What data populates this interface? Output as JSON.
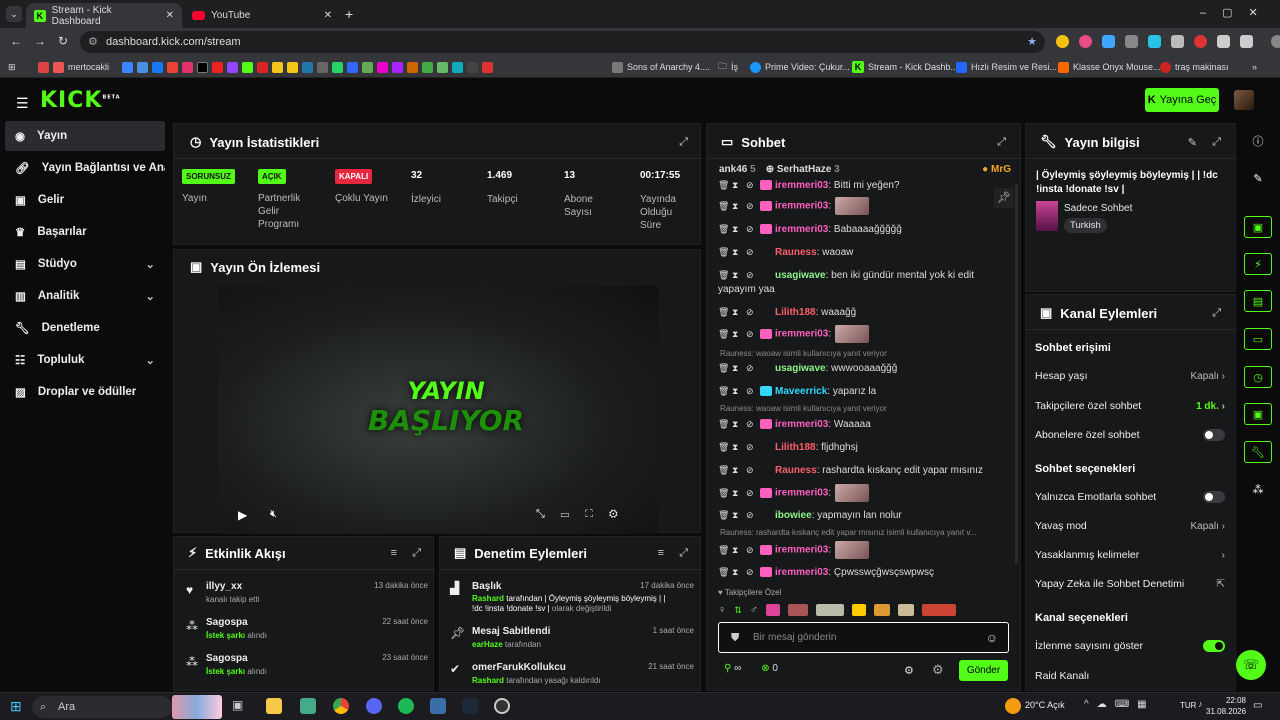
{
  "browser": {
    "tabs": [
      {
        "title": "Stream - Kick Dashboard",
        "active": true
      },
      {
        "title": "YouTube",
        "active": false
      }
    ],
    "url": "dashboard.kick.com/stream",
    "bookmarks": [
      "mertocakli",
      "Sons of Anarchy 4....",
      "İş",
      "Prime Video: Çukur...",
      "Stream - Kick Dashb...",
      "Hızlı Resim ve Resi...",
      "Klasse Onyx Mouse...",
      "traş makinası"
    ]
  },
  "app": {
    "logo": "KICK",
    "logo_sup": "BETA",
    "go_live": "Yayına Geç"
  },
  "sidebar": {
    "items": [
      {
        "label": "Yayın",
        "icon": "broadcast-icon",
        "active": true
      },
      {
        "label": "Yayın Bağlantısı ve Anahtarı",
        "icon": "link-icon"
      },
      {
        "label": "Gelir",
        "icon": "money-icon"
      },
      {
        "label": "Başarılar",
        "icon": "trophy-icon"
      },
      {
        "label": "Stüdyo",
        "icon": "studio-icon",
        "chevron": true
      },
      {
        "label": "Analitik",
        "icon": "chart-icon",
        "chevron": true
      },
      {
        "label": "Denetleme",
        "icon": "wrench-icon"
      },
      {
        "label": "Topluluk",
        "icon": "community-icon",
        "chevron": true
      },
      {
        "label": "Droplar ve ödüller",
        "icon": "gift-icon"
      }
    ]
  },
  "stats": {
    "title": "Yayın İstatistikleri",
    "items": [
      {
        "badge": "SORUNSUZ",
        "label": "Yayın"
      },
      {
        "badge": "AÇIK",
        "label": "Partnerlik Gelir Programı"
      },
      {
        "badge": "KAPALI",
        "label": "Çoklu Yayın"
      },
      {
        "value": "32",
        "label": "İzleyici"
      },
      {
        "value": "1.469",
        "label": "Takipçi"
      },
      {
        "value": "13",
        "label": "Abone Sayısı"
      },
      {
        "value": "00:17:55",
        "label": "Yayında Olduğu Süre"
      }
    ]
  },
  "preview": {
    "title": "Yayın Ön İzlemesi",
    "overlay_line1": "YAYIN",
    "overlay_line2": "BAŞLIYOR"
  },
  "activity": {
    "title": "Etkinlik Akışı",
    "items": [
      {
        "user": "illyy_xx",
        "text": "kanalı takip etti",
        "time": "13 dakika önce",
        "icon": "heart-icon"
      },
      {
        "user": "Sagospa",
        "hl": "İstek şarkı",
        "text": " alındı",
        "time": "22 saat önce",
        "icon": "puzzle-icon"
      },
      {
        "user": "Sagospa",
        "hl": "İstek şarkı",
        "text": " alındı",
        "time": "23 saat önce",
        "icon": "puzzle-icon"
      }
    ]
  },
  "mod_actions": {
    "title": "Denetim Eylemleri",
    "items": [
      {
        "title": "Başlık",
        "time": "17 dakika önce",
        "actor": "Rashard",
        "line1": " tarafından | Öyleymiş şöyleymiş böyleymiş | |",
        "line2": "!dc !insta !donate !sv |",
        "line2b": " olarak değiştirildi",
        "icon": "factory-icon"
      },
      {
        "title": "Mesaj Sabitlendi",
        "time": "1 saat önce",
        "actor": "earHaze",
        "line1": " tarafından",
        "icon": "pin-icon"
      },
      {
        "title": "omerFarukKollukcu",
        "time": "21 saat önce",
        "actor": "Rashard",
        "line1": " tarafından yasağı kaldırıldı",
        "icon": "check-circle-icon"
      }
    ]
  },
  "chat": {
    "title": "Sohbet",
    "top_users": [
      {
        "name": "ank46",
        "count": "5"
      },
      {
        "name": "SerhatHaze",
        "count": "3"
      },
      {
        "name": "MrG",
        "count": ""
      }
    ],
    "messages": [
      {
        "user": "iremmeri03",
        "cls": "u-pink",
        "text": ": Bitti mi yeğen?"
      },
      {
        "user": "iremmeri03",
        "cls": "u-pink",
        "text": ":",
        "img": true
      },
      {
        "user": "iremmeri03",
        "cls": "u-pink",
        "text": ": Babaaaağğğğğ"
      },
      {
        "user": "Rauness",
        "cls": "u-red",
        "text": ": waoaw"
      },
      {
        "user": "usagiwave",
        "cls": "u-lg",
        "text": ": ben iki gündür mental yok ki edit yapayım yaa"
      },
      {
        "user": "Lilith188",
        "cls": "u-red",
        "text": ": waaağğ"
      },
      {
        "user": "iremmeri03",
        "cls": "u-pink",
        "text": ":",
        "img": true
      },
      {
        "reply": "Rauness: waoaw isimli kullanıcıya yanıt veriyor"
      },
      {
        "user": "usagiwave",
        "cls": "u-lg",
        "text": ": wwwooaaağğğ"
      },
      {
        "user": "Maveerrick",
        "cls": "u-cyan",
        "text": ": yaparız la"
      },
      {
        "reply": "Rauness: waoaw isimli kullanıcıya yanıt veriyor"
      },
      {
        "user": "iremmeri03",
        "cls": "u-pink",
        "text": ": Waaaaa"
      },
      {
        "user": "Lilith188",
        "cls": "u-red",
        "text": ": fljdhghsj"
      },
      {
        "user": "Rauness",
        "cls": "u-red",
        "text": ": rashardta kıskanç edit yapar mısınız"
      },
      {
        "user": "iremmeri03",
        "cls": "u-pink",
        "text": ":",
        "img": true
      },
      {
        "user": "ibowiee",
        "cls": "u-lg",
        "text": ": yapmayın lan nolur"
      },
      {
        "reply": "Rauness: rashardta kıskanç edit yapar mısınız isimli kullanıcıya yanıt v..."
      },
      {
        "user": "iremmeri03",
        "cls": "u-pink",
        "text": ":",
        "img": true
      },
      {
        "user": "iremmeri03",
        "cls": "u-pink",
        "text": ": Çpwsswçğwsçswpwsç"
      }
    ],
    "follower_only_label": "Takipçilere Özel",
    "input_placeholder": "Bir mesaj gönderin",
    "points": "∞",
    "coins": "0",
    "send": "Gönder"
  },
  "stream_info": {
    "title": "Yayın bilgisi",
    "stream_title": "| Öyleymiş şöyleymiş böyleymiş | | !dc !insta !donate !sv |",
    "category": "Sadece Sohbet",
    "tag": "Turkish"
  },
  "channel_actions": {
    "title": "Kanal Eylemleri",
    "sec1": "Sohbet erişimi",
    "rows1": [
      {
        "label": "Hesap yaşı",
        "value": "Kapalı",
        "chev": true
      },
      {
        "label": "Takipçilere özel sohbet",
        "value": "1 dk.",
        "chev": true,
        "green": true
      },
      {
        "label": "Abonelere özel sohbet",
        "toggle": false
      }
    ],
    "sec2": "Sohbet seçenekleri",
    "rows2": [
      {
        "label": "Yalnızca Emotlarla sohbet",
        "toggle": false
      },
      {
        "label": "Yavaş mod",
        "value": "Kapalı",
        "chev": true
      },
      {
        "label": "Yasaklanmış kelimeler",
        "chev": true
      },
      {
        "label": "Yapay Zeka ile Sohbet Denetimi",
        "ext": true
      }
    ],
    "sec3": "Kanal seçenekleri",
    "rows3": [
      {
        "label": "İzlenme sayısını göster",
        "toggle": true
      },
      {
        "label": "Raid Kanalı"
      }
    ]
  },
  "taskbar": {
    "search": "Ara",
    "weather": "20°C",
    "weather_desc": "Açık",
    "lang": "TUR",
    "time": "22:08",
    "date": "31.08.2026"
  }
}
